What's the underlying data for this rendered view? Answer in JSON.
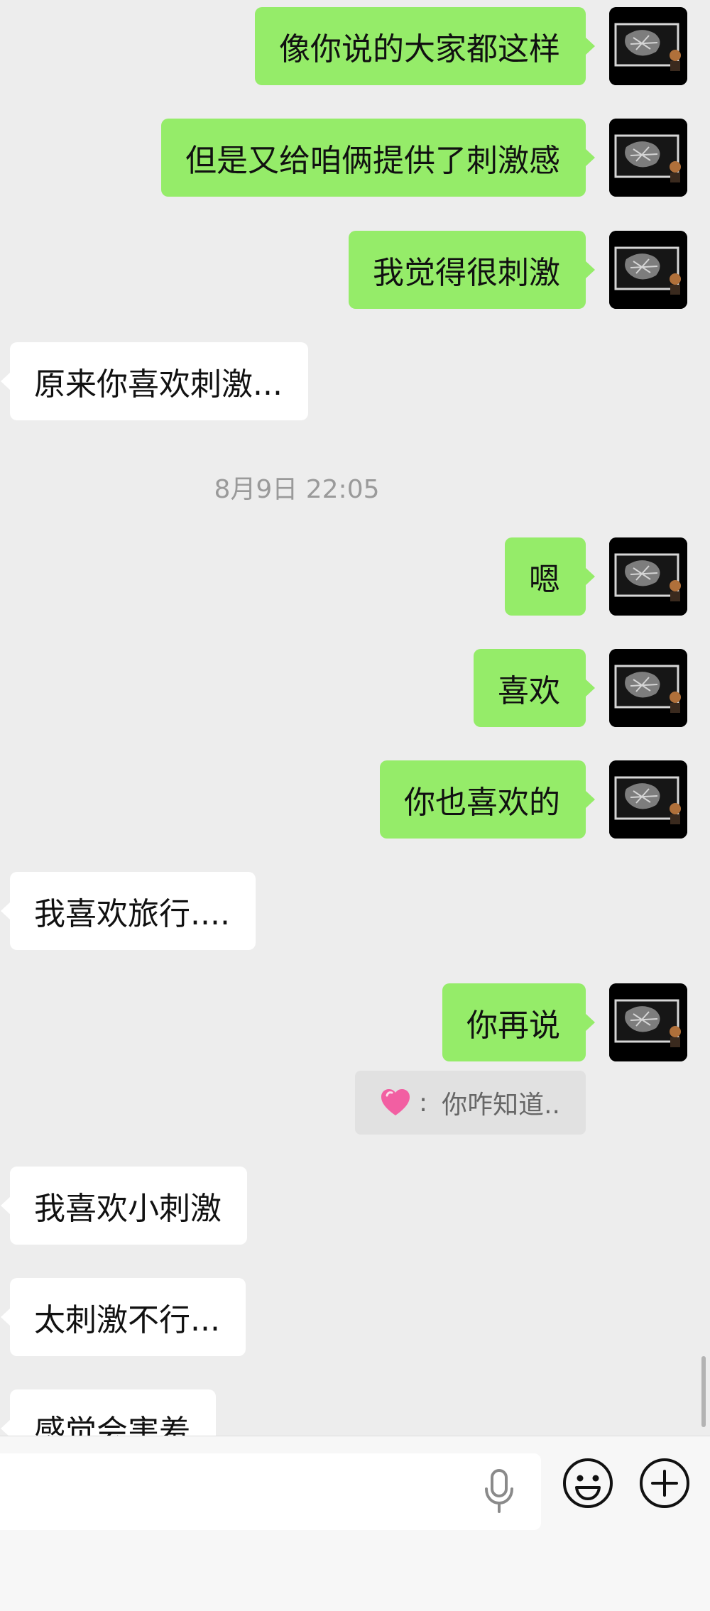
{
  "messages": [
    {
      "from": "me",
      "text": "像你说的大家都这样"
    },
    {
      "from": "me",
      "text": "但是又给咱俩提供了刺激感"
    },
    {
      "from": "me",
      "text": "我觉得很刺激"
    },
    {
      "from": "other",
      "text": "原来你喜欢刺激..."
    },
    {
      "timestamp": "8月9日 22:05"
    },
    {
      "from": "me",
      "text": "嗯"
    },
    {
      "from": "me",
      "text": "喜欢"
    },
    {
      "from": "me",
      "text": "你也喜欢的"
    },
    {
      "from": "other",
      "text": "我喜欢旅行...."
    },
    {
      "from": "me",
      "text": "你再说"
    },
    {
      "quote": {
        "separator": ":",
        "text": "你咋知道.."
      }
    },
    {
      "from": "other",
      "text": "我喜欢小刺激"
    },
    {
      "from": "other",
      "text": "太刺激不行..."
    },
    {
      "from": "other",
      "text": "感觉会害羞"
    }
  ],
  "input_bar": {
    "placeholder": "",
    "icons": [
      "microphone-icon",
      "emoji-icon",
      "plus-icon"
    ]
  },
  "colors": {
    "background": "#ededed",
    "sent_bubble": "#95ec69",
    "received_bubble": "#ffffff",
    "timestamp": "#9a9a9a",
    "quote_bg": "#e1e1e1",
    "input_bar_bg": "#f7f7f7"
  }
}
